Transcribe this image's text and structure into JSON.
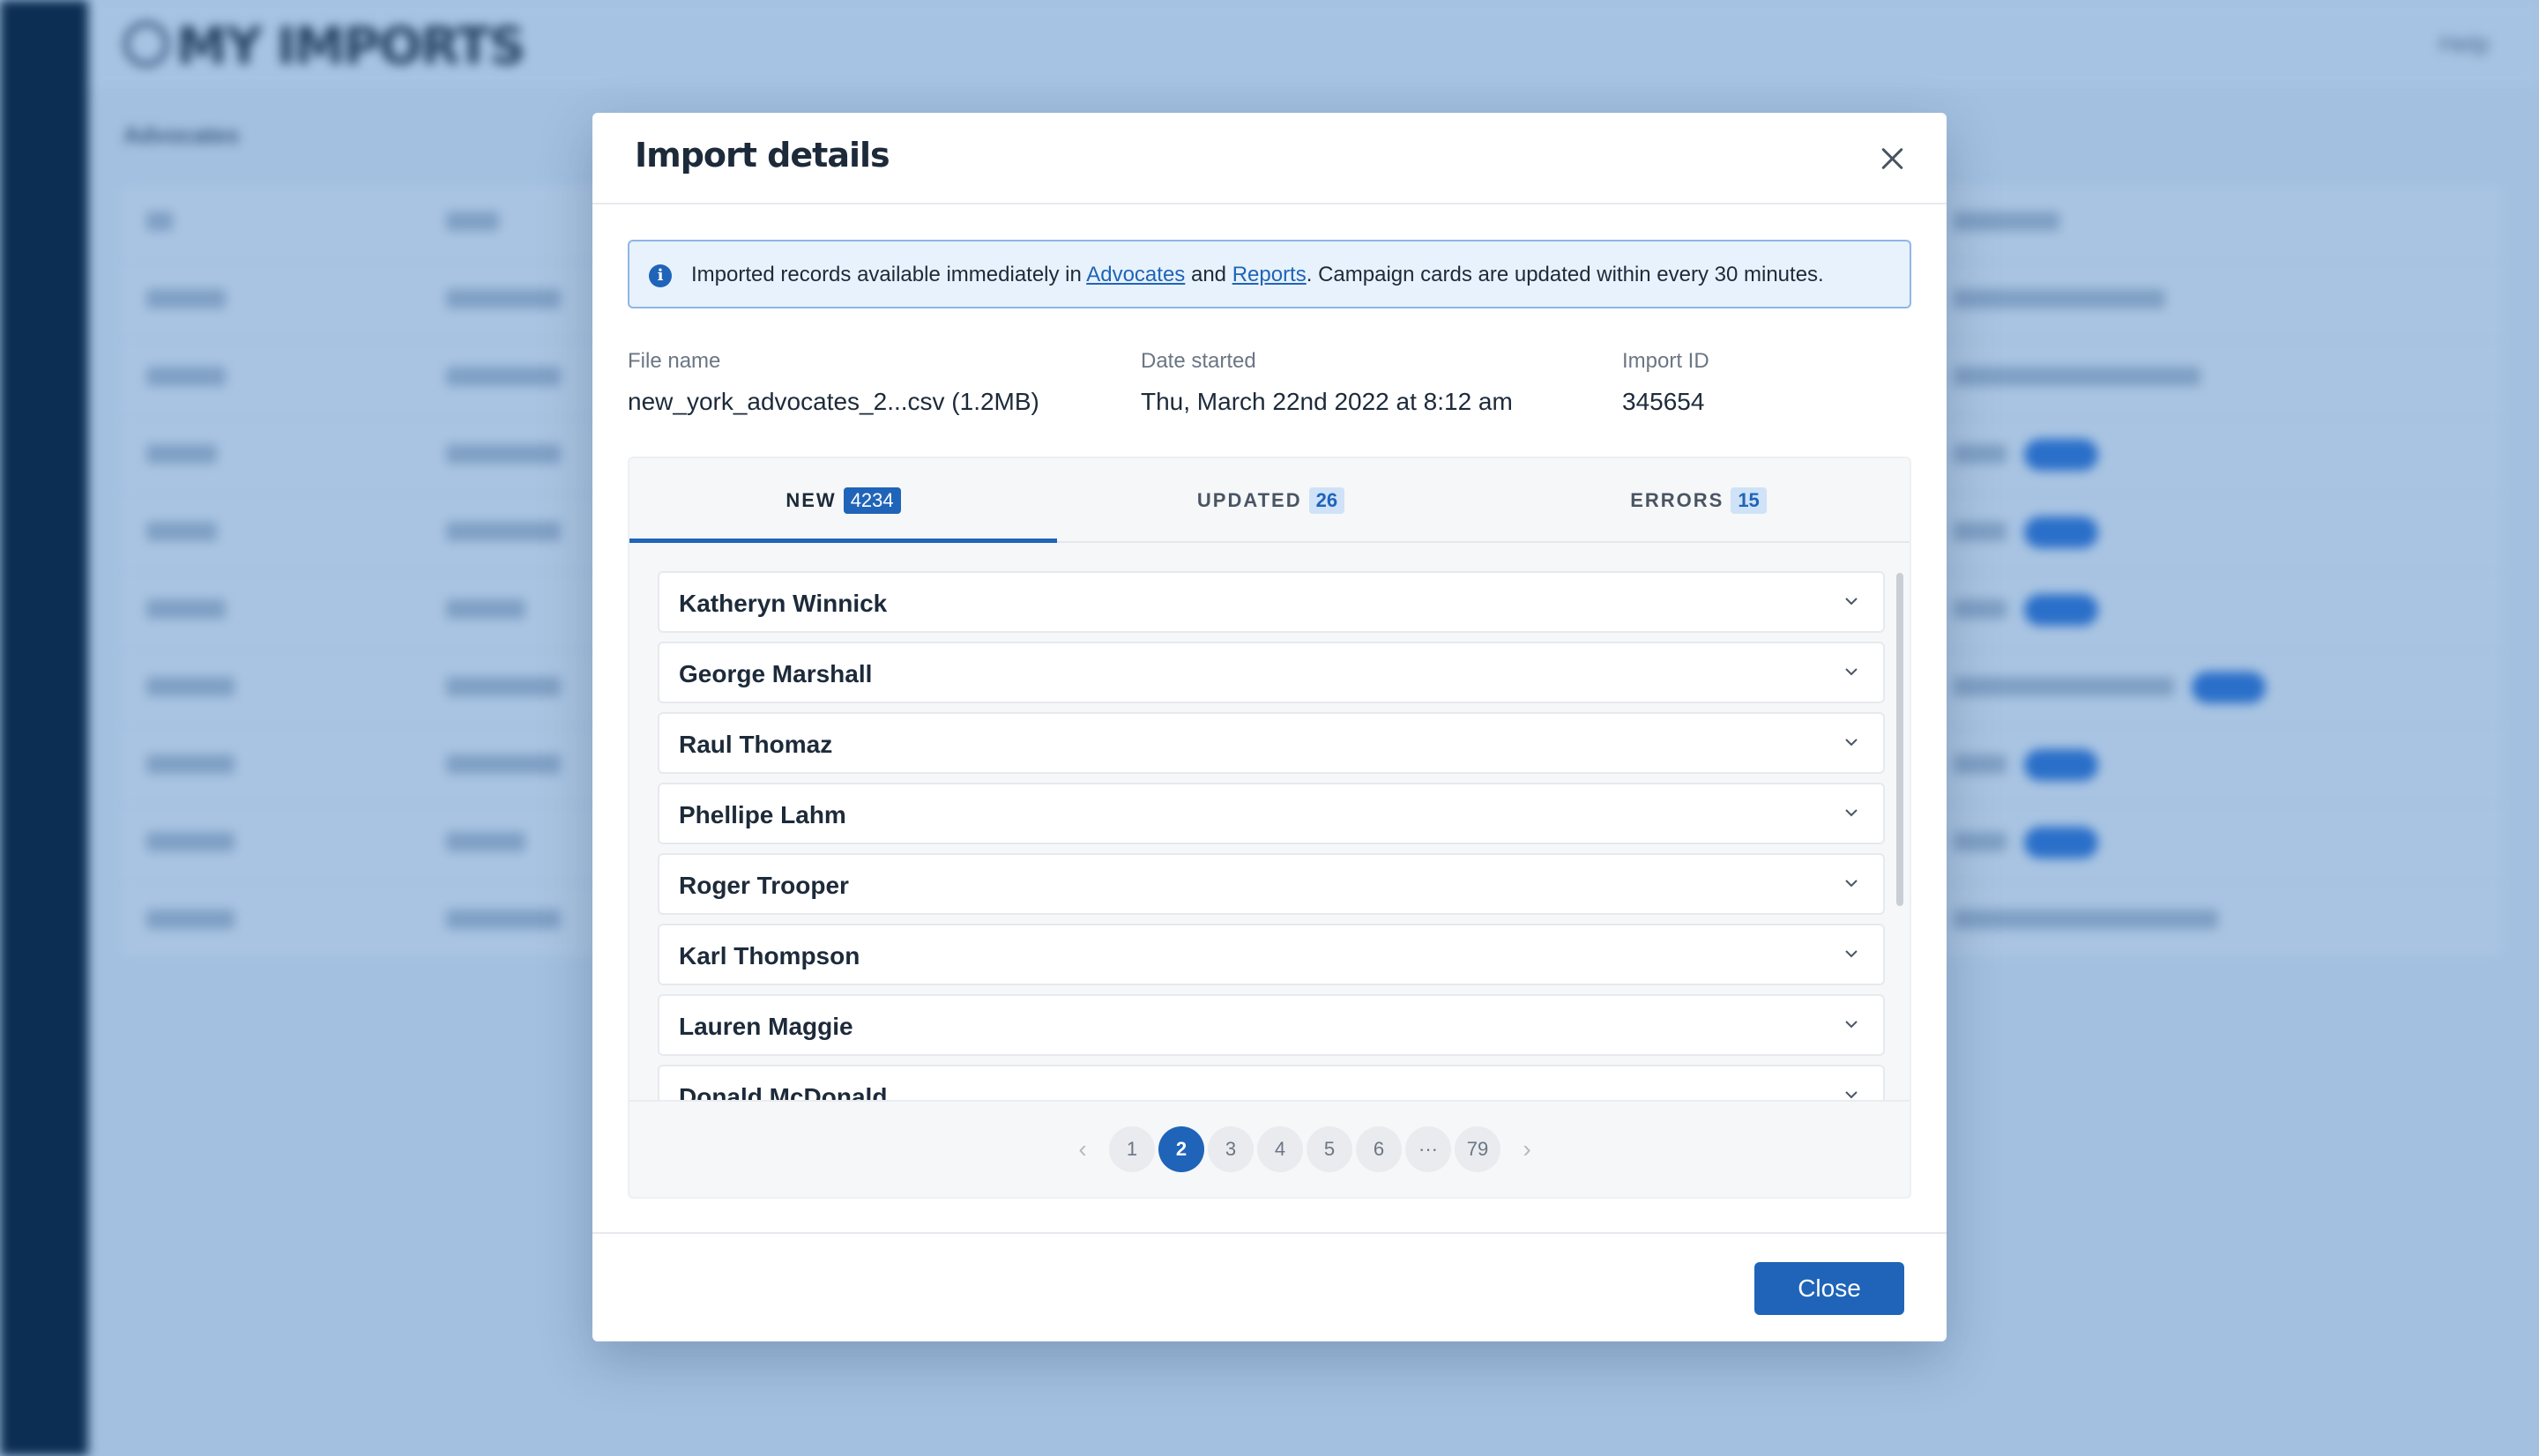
{
  "background": {
    "title": "MY IMPORTS",
    "help": "Help",
    "breadcrumb": "Advocates"
  },
  "modal": {
    "title": "Import details",
    "close_icon": "close-icon",
    "alert": {
      "icon": "info-icon",
      "text_before": "Imported records available immediately in ",
      "link_advocates": "Advocates",
      "text_middle": " and ",
      "link_reports": "Reports",
      "text_after": ". Campaign cards are updated within every 30 minutes."
    },
    "meta": {
      "file_name_label": "File name",
      "file_name": "new_york_advocates_2...csv (1.2MB)",
      "date_label": "Date started",
      "date": "Thu, March 22nd 2022 at 8:12 am",
      "import_id_label": "Import ID",
      "import_id": "345654"
    },
    "tabs": [
      {
        "label": "NEW",
        "count": "4234",
        "active": true
      },
      {
        "label": "UPDATED",
        "count": "26",
        "active": false
      },
      {
        "label": "ERRORS",
        "count": "15",
        "active": false
      }
    ],
    "records": [
      "Katheryn Winnick",
      "George Marshall",
      "Raul Thomaz",
      "Phellipe Lahm",
      "Roger Trooper",
      "Karl Thompson",
      "Lauren Maggie",
      "Donald McDonald"
    ],
    "pagination": {
      "prev": "‹",
      "next": "›",
      "pages": [
        "1",
        "2",
        "3",
        "4",
        "5",
        "6",
        "···",
        "79"
      ],
      "current": "2"
    },
    "close_button": "Close"
  },
  "colors": {
    "primary": "#1f64b8",
    "sidebar": "#0b2e52",
    "overlay": "#a3c0e0"
  }
}
